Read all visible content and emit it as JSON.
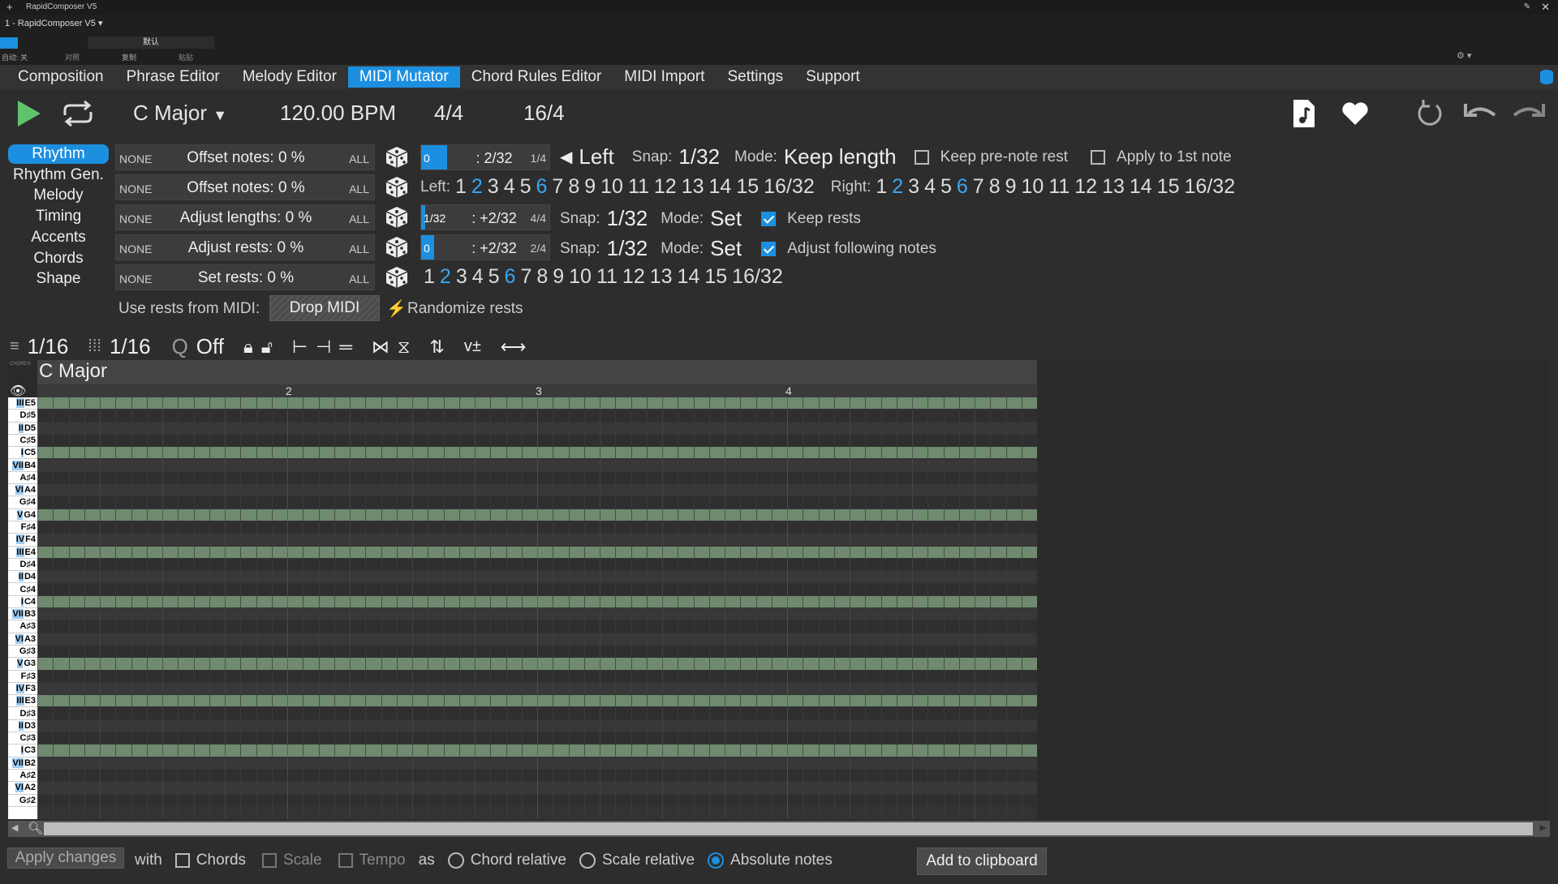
{
  "window": {
    "title": "RapidComposer V5",
    "subtitle": "1 - RapidComposer V5",
    "preset": "默认",
    "auto_label": "自动: 关",
    "compare_label": "对照",
    "copy_label": "复制",
    "paste_label": "粘贴"
  },
  "menu": [
    "Composition",
    "Phrase Editor",
    "Melody Editor",
    "MIDI Mutator",
    "Chord Rules Editor",
    "MIDI Import",
    "Settings",
    "Support"
  ],
  "menu_active": 3,
  "transport": {
    "key": "C Major",
    "tempo": "120.00 BPM",
    "time_sig": "4/4",
    "length": "16/4"
  },
  "sidebar": [
    "Rhythm",
    "Rhythm Gen.",
    "Melody",
    "Timing",
    "Accents",
    "Chords",
    "Shape"
  ],
  "sidebar_active": 0,
  "rows": [
    {
      "none": "NONE",
      "label": "Offset notes: 0 %",
      "all": "ALL"
    },
    {
      "none": "NONE",
      "label": "Offset notes: 0 %",
      "all": "ALL"
    },
    {
      "none": "NONE",
      "label": "Adjust lengths: 0 %",
      "all": "ALL"
    },
    {
      "none": "NONE",
      "label": "Adjust rests: 0 %",
      "all": "ALL"
    },
    {
      "none": "NONE",
      "label": "Set rests: 0 %",
      "all": "ALL"
    }
  ],
  "mini": [
    {
      "left": "0",
      "mid": ": 2/32",
      "right": "1/4",
      "fill": 0.2
    },
    {
      "left": "1/32",
      "mid": ": +2/32",
      "right": "4/4",
      "fill": 0.03
    },
    {
      "left": "0",
      "mid": ": +2/32",
      "right": "2/4",
      "fill": 0.1
    }
  ],
  "line1": {
    "dir": "Left",
    "snap_label": "Snap:",
    "snap": "1/32",
    "mode_label": "Mode:",
    "mode": "Keep length",
    "keep_pre": "Keep pre-note rest",
    "apply_first": "Apply to 1st note"
  },
  "line2": {
    "left_label": "Left:",
    "right_label": "Right:"
  },
  "line3": {
    "snap_label": "Snap:",
    "snap": "1/32",
    "mode_label": "Mode:",
    "mode": "Set",
    "cb": "Keep rests"
  },
  "line4": {
    "snap_label": "Snap:",
    "snap": "1/32",
    "mode_label": "Mode:",
    "mode": "Set",
    "cb": "Adjust following notes"
  },
  "nums": [
    "1",
    "2",
    "3",
    "4",
    "5",
    "6",
    "7",
    "8",
    "9",
    "10",
    "11",
    "12",
    "13",
    "14",
    "15",
    "16/32"
  ],
  "midi_row": {
    "label": "Use rests from MIDI:",
    "drop": "Drop MIDI",
    "rand": "Randomize rests"
  },
  "pr_toolbar": {
    "grid1": "1/16",
    "grid2": "1/16",
    "q": "Q",
    "q_val": "Off"
  },
  "pianoroll": {
    "chord": "C Major",
    "bars": [
      "2",
      "3",
      "4"
    ],
    "chords_tag": "CHORDS"
  },
  "keys": [
    {
      "deg": "III",
      "n": "E5"
    },
    {
      "deg": "",
      "n": "D♯5"
    },
    {
      "deg": "II",
      "n": "D5"
    },
    {
      "deg": "",
      "n": "C♯5"
    },
    {
      "deg": "I",
      "n": "C5"
    },
    {
      "deg": "VII",
      "n": "B4"
    },
    {
      "deg": "",
      "n": "A♯4"
    },
    {
      "deg": "VI",
      "n": "A4"
    },
    {
      "deg": "",
      "n": "G♯4"
    },
    {
      "deg": "V",
      "n": "G4"
    },
    {
      "deg": "",
      "n": "F♯4"
    },
    {
      "deg": "IV",
      "n": "F4"
    },
    {
      "deg": "III",
      "n": "E4"
    },
    {
      "deg": "",
      "n": "D♯4"
    },
    {
      "deg": "II",
      "n": "D4"
    },
    {
      "deg": "",
      "n": "C♯4"
    },
    {
      "deg": "I",
      "n": "C4"
    },
    {
      "deg": "VII",
      "n": "B3"
    },
    {
      "deg": "",
      "n": "A♯3"
    },
    {
      "deg": "VI",
      "n": "A3"
    },
    {
      "deg": "",
      "n": "G♯3"
    },
    {
      "deg": "V",
      "n": "G3"
    },
    {
      "deg": "",
      "n": "F♯3"
    },
    {
      "deg": "IV",
      "n": "F3"
    },
    {
      "deg": "III",
      "n": "E3"
    },
    {
      "deg": "",
      "n": "D♯3"
    },
    {
      "deg": "II",
      "n": "D3"
    },
    {
      "deg": "",
      "n": "C♯3"
    },
    {
      "deg": "I",
      "n": "C3"
    },
    {
      "deg": "VII",
      "n": "B2"
    },
    {
      "deg": "",
      "n": "A♯2"
    },
    {
      "deg": "VI",
      "n": "A2"
    },
    {
      "deg": "",
      "n": "G♯2"
    }
  ],
  "bottom": {
    "apply": "Apply changes",
    "with": "with",
    "chords": "Chords",
    "scale": "Scale",
    "tempo": "Tempo",
    "as": "as",
    "chord_rel": "Chord relative",
    "scale_rel": "Scale relative",
    "abs": "Absolute notes",
    "clip": "Add to clipboard"
  },
  "colors": {
    "accent": "#1d8fe0",
    "scale_row": "#6f8a6f",
    "bg": "#2d2d2d"
  }
}
